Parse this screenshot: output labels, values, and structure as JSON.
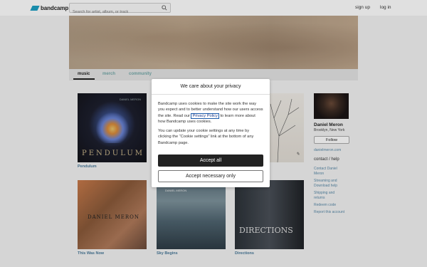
{
  "header": {
    "logo": "bandcamp",
    "search_placeholder": "Search for artist, album, or track",
    "signup": "sign up",
    "login": "log in"
  },
  "nav": {
    "tabs": [
      "music",
      "merch",
      "community"
    ]
  },
  "albums": [
    {
      "title": "Pendulum",
      "cover_word": "PENDULUM",
      "cover_small": "DANIEL MERON"
    },
    {
      "title": "This Was Now",
      "cover_text": "DANIEL MERON"
    },
    {
      "title": "Sky Begins",
      "cover_text": "DANIEL MERON"
    },
    {
      "title": "Directions",
      "cover_text": "DIRECTIONS"
    }
  ],
  "sidebar": {
    "artist_name": "Daniel Meron",
    "location": "Brooklyn, New York",
    "follow": "Follow",
    "website": "danielmeron.com",
    "contact_heading": "contact / help",
    "links": [
      "Contact Daniel Meron",
      "Streaming and Download help",
      "Shipping and returns",
      "Redeem code",
      "Report this account"
    ]
  },
  "cookie_modal": {
    "title": "We care about your privacy",
    "p1_before": "Bandcamp uses cookies to make the site work the way you expect and to better understand how our users access the site. Read our ",
    "p1_link": "Privacy Policy",
    "p1_after": " to learn more about how Bandcamp uses cookies.",
    "p2": "You can update your cookie settings at any time by clicking the “Cookie settings” link at the bottom of any Bandcamp page.",
    "accept_all": "Accept all",
    "accept_necessary": "Accept necessary only"
  }
}
